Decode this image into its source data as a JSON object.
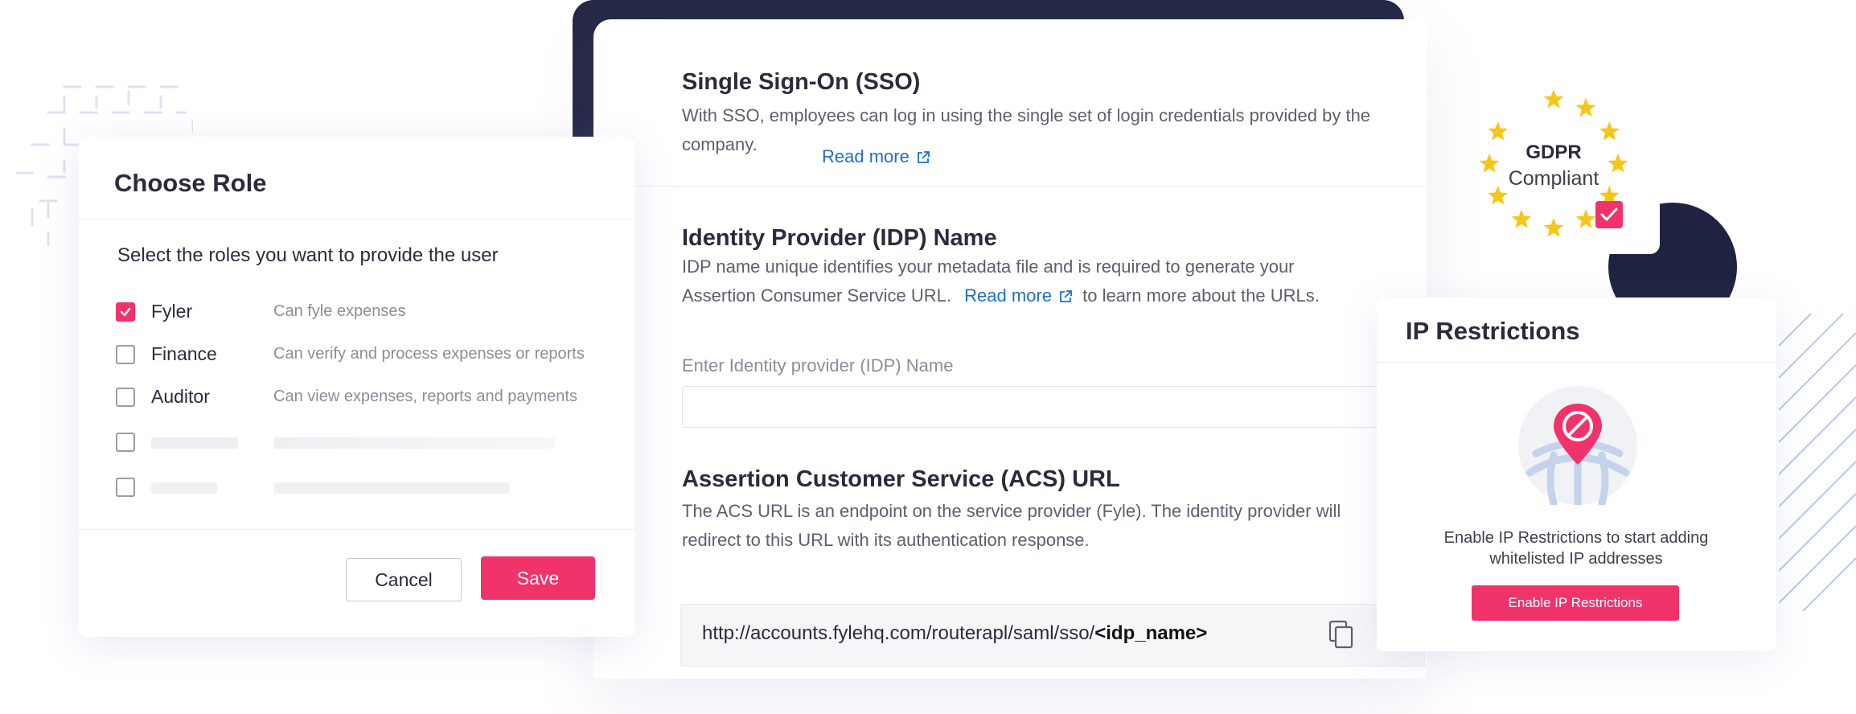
{
  "sso": {
    "title": "Single Sign-On (SSO)",
    "desc_line1": "With SSO, employees can log in using the single set of login credentials provided by the",
    "desc_line2": "company.",
    "read_more": "Read more",
    "idp_title": "Identity Provider (IDP) Name",
    "idp_desc_line1": "IDP name unique identifies your metadata file and is required to generate your",
    "idp_desc_line2_prefix": "Assertion Consumer Service URL.",
    "idp_read_more": "Read more",
    "idp_desc_line2_suffix": "to learn more about the URLs.",
    "idp_field_label": "Enter Identity provider (IDP) Name",
    "idp_field_value": "",
    "acs_title": "Assertion Customer Service (ACS) URL",
    "acs_desc_line1": "The ACS URL is an endpoint on the service provider (Fyle). The identity provider will",
    "acs_desc_line2": "redirect to this URL with its authentication response.",
    "acs_url_base": "http://accounts.fylehq.com/routerapl/saml/sso/",
    "acs_url_param": "<idp_name>",
    "copy_icon": "copy-icon"
  },
  "gdpr": {
    "line1": "GDPR",
    "line2": "Compliant",
    "star_color": "#f5c518",
    "check_color": "#f0336b"
  },
  "role_modal": {
    "title": "Choose Role",
    "subtitle": "Select the roles you want to provide the user",
    "roles": [
      {
        "name": "Fyler",
        "desc": "Can fyle expenses",
        "checked": true
      },
      {
        "name": "Finance",
        "desc": "Can verify and process expenses or reports",
        "checked": false
      },
      {
        "name": "Auditor",
        "desc": "Can view expenses, reports and payments",
        "checked": false
      }
    ],
    "cancel_label": "Cancel",
    "save_label": "Save"
  },
  "ip_restrictions": {
    "title": "IP Restrictions",
    "desc_line1": "Enable IP Restrictions to start adding",
    "desc_line2": "whitelisted IP addresses",
    "button_label": "Enable IP Restrictions"
  },
  "colors": {
    "accent": "#f0336b",
    "link": "#1f6fc4",
    "frame_dark": "#262a47"
  }
}
